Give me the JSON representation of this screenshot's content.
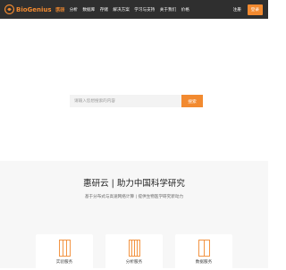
{
  "header": {
    "brand": "BioGenius",
    "brand_sub": "惠研",
    "nav": [
      "实验",
      "分析",
      "数据库",
      "存储",
      "解决方案",
      "学习与支持",
      "关于我们",
      "价格"
    ],
    "login": "注册",
    "register": "登录"
  },
  "search": {
    "placeholder": "请输入您想搜索的内容",
    "button": "搜索"
  },
  "intro": {
    "headline": "惠研云 | 助力中国科学研究",
    "tagline": "基于分布式与高速网络计算 | 提供生物医学研究新动力"
  },
  "cards": [
    {
      "label": "实验服务",
      "icon": "experiment-icon"
    },
    {
      "label": "分析服务",
      "icon": "analysis-icon"
    },
    {
      "label": "数据服务",
      "icon": "data-icon"
    }
  ],
  "colors": {
    "accent": "#f28a30",
    "topbar": "#2f2f2f"
  }
}
